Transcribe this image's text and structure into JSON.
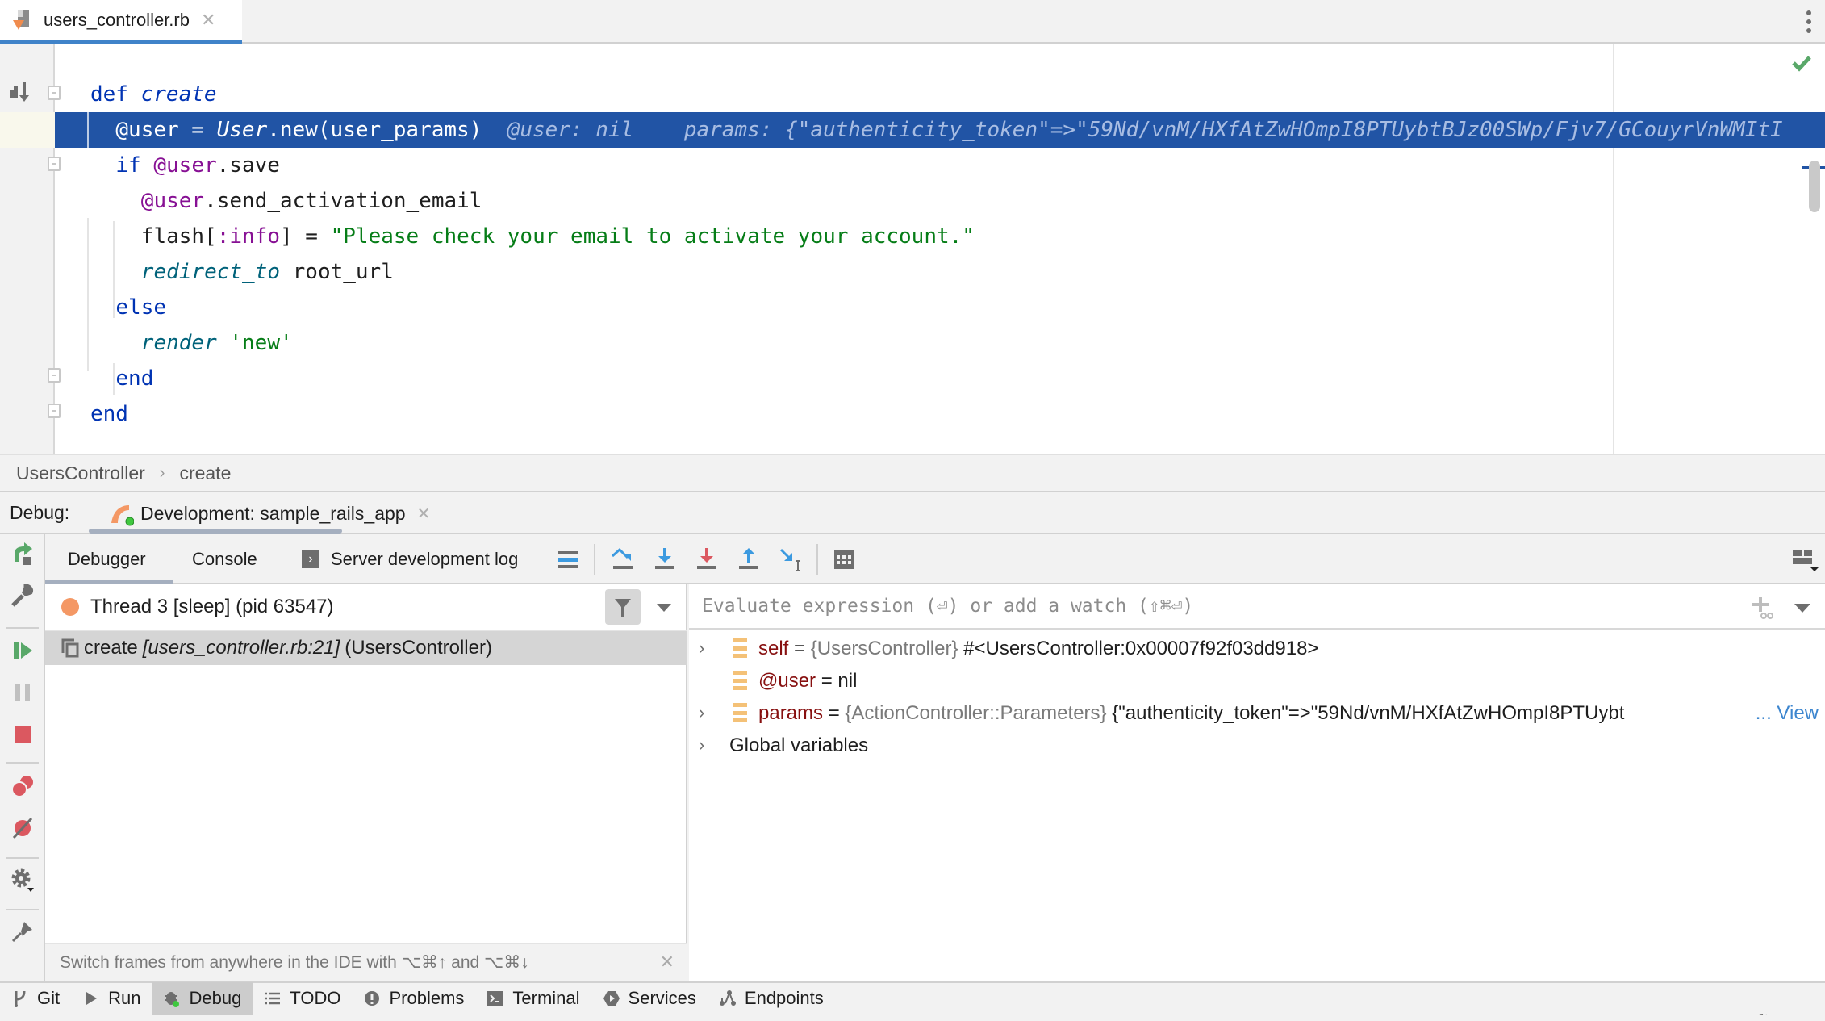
{
  "editor_tab": {
    "filename": "users_controller.rb",
    "file_icon": "ruby-file-icon",
    "close_icon": "close-icon"
  },
  "code": {
    "lines": [
      {
        "tokens": [
          [
            "kw",
            "def "
          ],
          [
            "fn",
            "create"
          ]
        ]
      },
      {
        "tokens": [
          [
            "plain",
            "@user = "
          ],
          [
            "plain-it",
            "User"
          ],
          [
            "plain",
            ".new(user_params)"
          ]
        ],
        "inline_debug": "@user: nil    params: {\"authenticity_token\"=>\"59Nd/vnM/HXfAtZwHOmpI8PTUybtBJz00SWp/Fjv7/GCouyrVnWMItI",
        "execution_point": true,
        "breakpoint": true
      },
      {
        "tokens": [
          [
            "kw",
            "if "
          ],
          [
            "ivar",
            "@user"
          ],
          [
            "plain",
            ".save"
          ]
        ]
      },
      {
        "tokens": [
          [
            "ivar",
            "@user"
          ],
          [
            "plain",
            ".send_activation_email"
          ]
        ]
      },
      {
        "tokens": [
          [
            "plain",
            "flash["
          ],
          [
            "sym",
            ":info"
          ],
          [
            "plain",
            "] = "
          ],
          [
            "str",
            "\"Please check your email to activate your account.\""
          ]
        ]
      },
      {
        "tokens": [
          [
            "meth",
            "redirect_to"
          ],
          [
            "plain",
            " root_url"
          ]
        ]
      },
      {
        "tokens": [
          [
            "kw",
            "else"
          ]
        ]
      },
      {
        "tokens": [
          [
            "meth",
            "render"
          ],
          [
            "plain",
            " "
          ],
          [
            "str",
            "'new'"
          ]
        ]
      },
      {
        "tokens": [
          [
            "kw",
            "end"
          ]
        ]
      },
      {
        "tokens": [
          [
            "kw",
            "end"
          ]
        ]
      }
    ],
    "status_icon": "check-icon"
  },
  "breadcrumb": {
    "items": [
      "UsersController",
      "create"
    ]
  },
  "debug_header": {
    "label": "Debug:",
    "run_config": "Development: sample_rails_app"
  },
  "debug_tabs": {
    "debugger": "Debugger",
    "console": "Console",
    "server_log": "Server development log"
  },
  "frames": {
    "thread": "Thread 3 [sleep] (pid 63547)",
    "frame": {
      "method": "create",
      "location": "[users_controller.rb:21]",
      "class": "(UsersController)"
    },
    "hint": "Switch frames from anywhere in the IDE with ⌥⌘↑ and ⌥⌘↓"
  },
  "variables": {
    "eval_placeholder": "Evaluate expression (⏎) or add a watch (⇧⌘⏎)",
    "items": [
      {
        "name": "self",
        "eq": " = ",
        "type": "{UsersController}",
        "value": " #<UsersController:0x00007f92f03dd918>",
        "expandable": true
      },
      {
        "name": "@user",
        "eq": " = ",
        "type": "",
        "value": "nil",
        "expandable": false
      },
      {
        "name": "params",
        "eq": " = ",
        "type": "{ActionController::Parameters}",
        "value": " {\"authenticity_token\"=>\"59Nd/vnM/HXfAtZwHOmpI8PTUybt",
        "link": "... View",
        "expandable": true
      }
    ],
    "globals": "Global variables"
  },
  "bottom_bar": {
    "items": [
      {
        "label": "Git",
        "icon": "git-branch-icon"
      },
      {
        "label": "Run",
        "icon": "run-icon"
      },
      {
        "label": "Debug",
        "icon": "bug-icon",
        "active": true
      },
      {
        "label": "TODO",
        "icon": "list-icon"
      },
      {
        "label": "Problems",
        "icon": "problems-icon"
      },
      {
        "label": "Terminal",
        "icon": "terminal-icon"
      },
      {
        "label": "Services",
        "icon": "services-icon"
      },
      {
        "label": "Endpoints",
        "icon": "endpoints-icon"
      }
    ]
  },
  "colors": {
    "accent": "#4083c9",
    "execution_line": "#2154a5",
    "breakpoint": "#db5860",
    "resume": "#59a869",
    "thread_dot": "#f49865"
  }
}
